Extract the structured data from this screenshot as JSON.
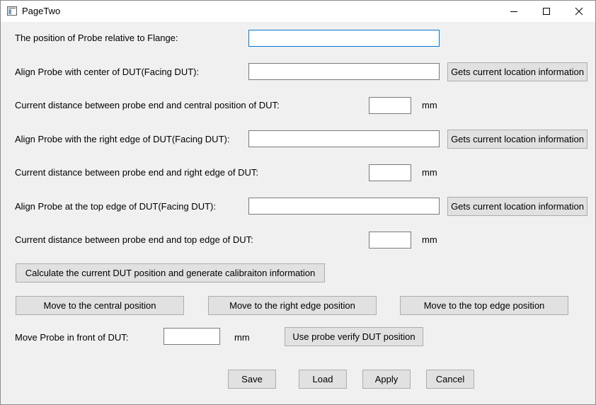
{
  "window": {
    "title": "PageTwo",
    "controls": {
      "minimize": "minimize-icon",
      "maximize": "maximize-icon",
      "close": "close-icon"
    }
  },
  "unit": "mm",
  "rows": {
    "probe_flange": {
      "label": "The position of Probe relative to Flange:",
      "value": ""
    },
    "align_center": {
      "label": "Align Probe with center of DUT(Facing DUT):",
      "value": "",
      "button": "Gets current location information"
    },
    "dist_center": {
      "label": "Current distance between probe end and central position of DUT:",
      "value": ""
    },
    "align_right": {
      "label": "Align Probe with the right edge of DUT(Facing DUT):",
      "value": "",
      "button": "Gets current location information"
    },
    "dist_right": {
      "label": "Current distance between probe end and right edge of DUT:",
      "value": ""
    },
    "align_top": {
      "label": "Align Probe at the top edge of DUT(Facing DUT):",
      "value": "",
      "button": "Gets current location information"
    },
    "dist_top": {
      "label": "Current distance between probe end and top edge of DUT:",
      "value": ""
    }
  },
  "calculate_button": "Calculate the current DUT position and generate calibraiton information",
  "move_buttons": {
    "central": "Move to the central position",
    "right": "Move to the right edge position",
    "top": "Move to the top edge position"
  },
  "front": {
    "label": "Move Probe in front of DUT:",
    "value": "",
    "verify_button": "Use probe verify DUT position"
  },
  "footer": {
    "save": "Save",
    "load": "Load",
    "apply": "Apply",
    "cancel": "Cancel"
  }
}
